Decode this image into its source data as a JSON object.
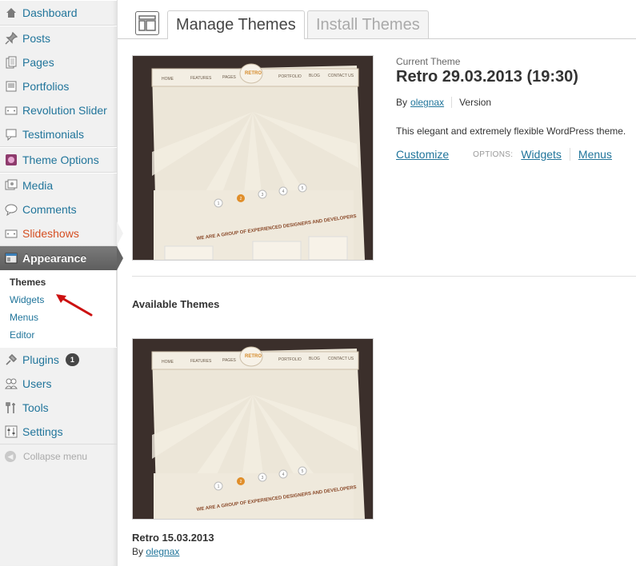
{
  "sidebar": {
    "items": [
      {
        "label": "Dashboard",
        "icon": "dashboard-icon"
      },
      {
        "label": "Posts",
        "icon": "pin-icon"
      },
      {
        "label": "Pages",
        "icon": "pages-icon"
      },
      {
        "label": "Portfolios",
        "icon": "portfolio-icon"
      },
      {
        "label": "Revolution Slider",
        "icon": "slider-icon"
      },
      {
        "label": "Testimonials",
        "icon": "speech-icon"
      },
      {
        "label": "Theme Options",
        "icon": "theme-options-icon"
      },
      {
        "label": "Media",
        "icon": "media-icon"
      },
      {
        "label": "Comments",
        "icon": "comment-icon"
      },
      {
        "label": "Slideshows",
        "icon": "slideshow-icon"
      },
      {
        "label": "Appearance",
        "icon": "appearance-icon"
      },
      {
        "label": "Plugins",
        "icon": "plugin-icon",
        "badge": "1"
      },
      {
        "label": "Users",
        "icon": "users-icon"
      },
      {
        "label": "Tools",
        "icon": "tools-icon"
      },
      {
        "label": "Settings",
        "icon": "settings-icon"
      }
    ],
    "appearance_submenu": [
      "Themes",
      "Widgets",
      "Menus",
      "Editor"
    ],
    "collapse_label": "Collapse menu"
  },
  "tabs": {
    "manage": "Manage Themes",
    "install": "Install Themes"
  },
  "current_theme": {
    "label": "Current Theme",
    "title": "Retro 29.03.2013 (19:30)",
    "by_label": "By",
    "author": "olegnax",
    "version_label": "Version",
    "description": "This elegant and extremely flexible WordPress theme.",
    "customize": "Customize",
    "options_label": "OPTIONS:",
    "widgets": "Widgets",
    "menus": "Menus"
  },
  "available": {
    "heading": "Available Themes",
    "themes": [
      {
        "name": "Retro 15.03.2013",
        "by_label": "By",
        "author": "olegnax"
      }
    ]
  },
  "preview": {
    "nav": [
      "HOME",
      "FEATURES",
      "PAGES",
      "PORTFOLIO",
      "BLOG",
      "CONTACT US"
    ],
    "logo": "RETRO",
    "steps": [
      "1",
      "2",
      "3",
      "4",
      "5"
    ],
    "tagline": "WE ARE A GROUP OF EXPERIENCED DESIGNERS AND DEVELOPERS"
  },
  "colors": {
    "link": "#21759b",
    "current_menu": "#646464",
    "slideshow_active": "#d54e21",
    "arrow": "#cc1111"
  }
}
